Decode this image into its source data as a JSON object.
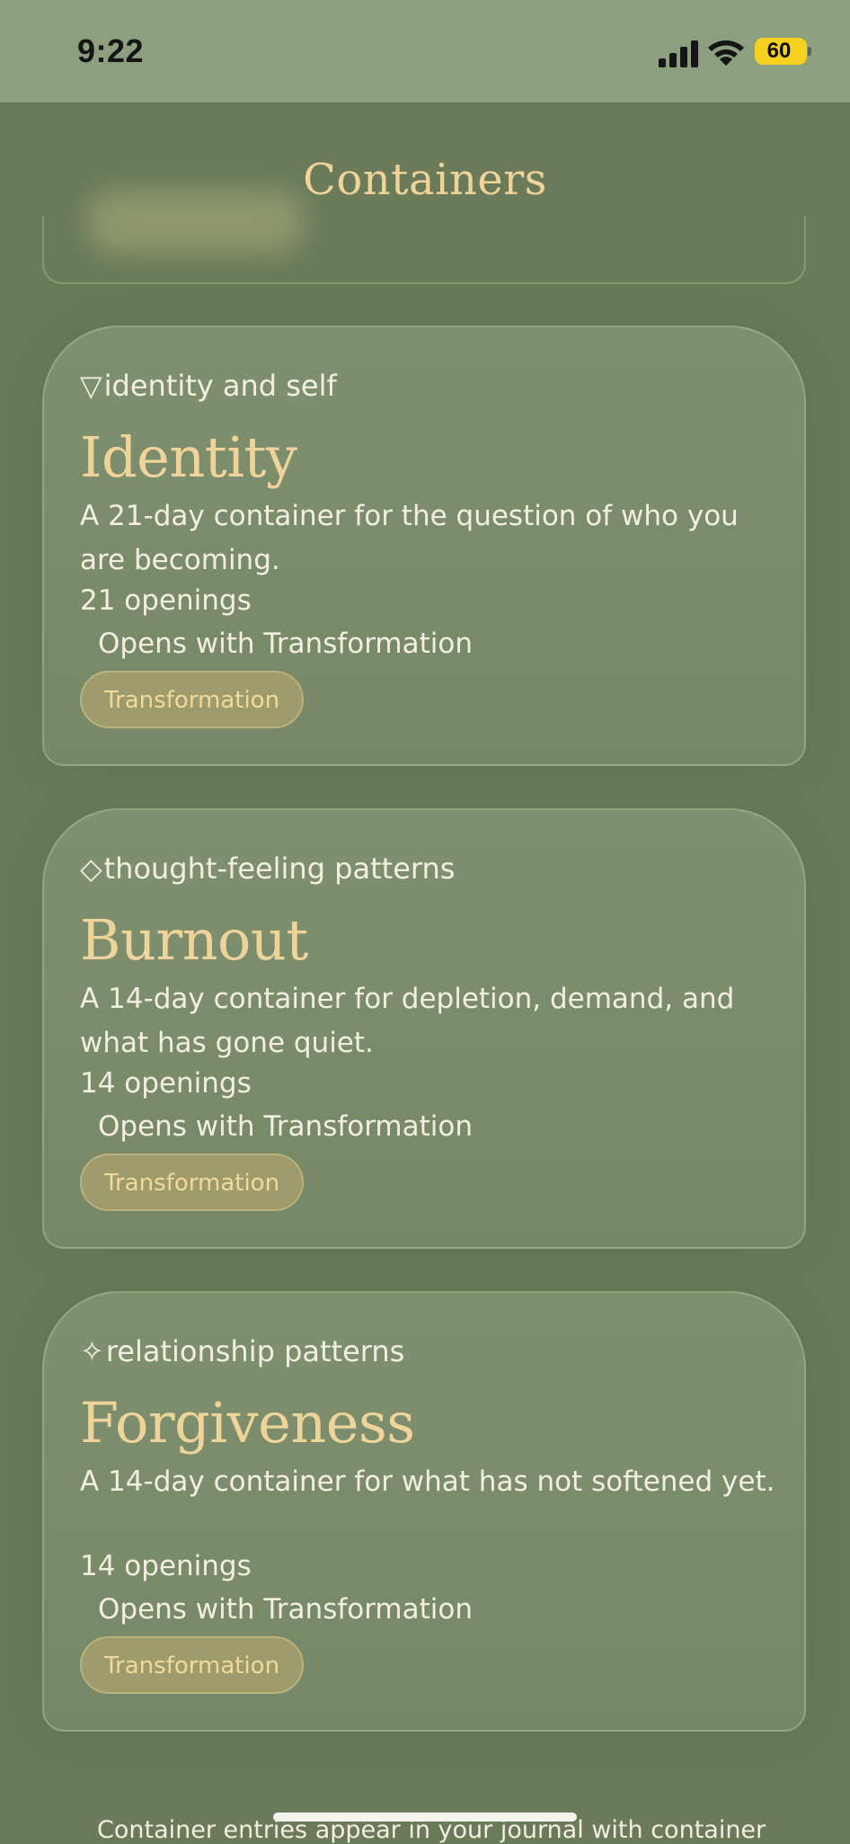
{
  "status_bar": {
    "time": "9:22",
    "battery": "60",
    "signal_icon": "cellular-signal-icon",
    "wifi_icon": "wifi-icon"
  },
  "header": {
    "title": "Containers"
  },
  "cards": [
    {
      "category_icon": "▽",
      "category": "identity and self",
      "title": "Identity",
      "description": "A 21-day container for the question of who you are becoming.",
      "openings": "21 openings",
      "opens_with": "Opens with Transformation",
      "tag": "Transformation"
    },
    {
      "category_icon": "◇",
      "category": "thought-feeling patterns",
      "title": "Burnout",
      "description": "A 14-day container for depletion, demand, and what has gone quiet.",
      "openings": "14 openings",
      "opens_with": "Opens with Transformation",
      "tag": "Transformation"
    },
    {
      "category_icon": "✧",
      "category": "relationship patterns",
      "title": "Forgiveness",
      "description": "A 14-day container for what has not softened yet.",
      "openings": "14 openings",
      "opens_with": "Opens with Transformation",
      "tag": "Transformation"
    }
  ],
  "footer": {
    "note": "Container entries appear in your journal with container"
  },
  "colors": {
    "background": "#6b7b5a",
    "status_bar": "#8c9f7e",
    "accent_gold": "#efd49a",
    "card": "#7f9070",
    "battery": "#f6d01e"
  }
}
